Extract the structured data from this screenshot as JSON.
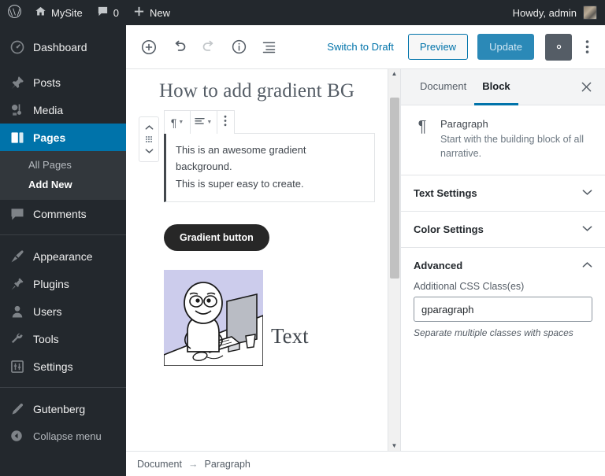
{
  "adminbar": {
    "logo_icon": "wordpress-logo-icon",
    "site": {
      "icon": "home-icon",
      "label": "MySite"
    },
    "comments": {
      "icon": "comment-bubble-icon",
      "count": "0"
    },
    "new": {
      "icon": "plus-icon",
      "label": "New"
    },
    "account": {
      "greeting": "Howdy, admin",
      "avatar": "user-avatar"
    }
  },
  "sidebar": {
    "items": [
      {
        "label": "Dashboard",
        "icon": "dashboard-icon",
        "current": false
      },
      {
        "label": "Posts",
        "icon": "pin-icon",
        "current": false
      },
      {
        "label": "Media",
        "icon": "media-icon",
        "current": false
      },
      {
        "label": "Pages",
        "icon": "pages-icon",
        "current": true
      },
      {
        "label": "Comments",
        "icon": "comment-icon",
        "current": false
      },
      {
        "label": "Appearance",
        "icon": "appearance-brush-icon",
        "current": false
      },
      {
        "label": "Plugins",
        "icon": "plugin-plug-icon",
        "current": false
      },
      {
        "label": "Users",
        "icon": "user-icon",
        "current": false
      },
      {
        "label": "Tools",
        "icon": "wrench-icon",
        "current": false
      },
      {
        "label": "Settings",
        "icon": "settings-sliders-icon",
        "current": false
      },
      {
        "label": "Gutenberg",
        "icon": "pencil-icon",
        "current": false
      }
    ],
    "submenu": [
      {
        "label": "All Pages",
        "current": false
      },
      {
        "label": "Add New",
        "current": true
      }
    ],
    "collapse": {
      "label": "Collapse menu",
      "icon": "collapse-arrow-icon"
    }
  },
  "toolbar": {
    "add_block": "add-block-icon",
    "undo": "undo-icon",
    "redo": "redo-icon",
    "info": "info-icon",
    "list_view": "list-view-icon",
    "switch_to_draft": "Switch to Draft",
    "preview": "Preview",
    "update": "Update",
    "settings_gear": "gear-icon",
    "more_menu": "kebab-menu-icon"
  },
  "canvas": {
    "post_title": "How to add gradient BG",
    "block_toolbar": {
      "paragraph_glyph": "¶",
      "align_glyph": "align-left-icon",
      "more_glyph": "kebab-menu-icon"
    },
    "mover": {
      "up": "chevron-up-icon",
      "drag": "drag-handle-icon",
      "down": "chevron-down-icon"
    },
    "paragraph_lines": [
      "This is an awesome gradient background.",
      "This is super easy to create."
    ],
    "gradient_button_label": "Gradient button",
    "media_text": "Text",
    "media_image_alt": "rage-comic-at-computer-meme"
  },
  "inspector": {
    "tabs": [
      {
        "label": "Document",
        "active": false
      },
      {
        "label": "Block",
        "active": true
      }
    ],
    "close_icon": "close-icon",
    "block_card": {
      "icon": "¶",
      "title": "Paragraph",
      "description": "Start with the building block of all narrative."
    },
    "panels": [
      {
        "label": "Text Settings",
        "expanded": false,
        "chevron": "chevron-down-icon"
      },
      {
        "label": "Color Settings",
        "expanded": false,
        "chevron": "chevron-down-icon"
      },
      {
        "label": "Advanced",
        "expanded": true,
        "chevron": "chevron-up-icon"
      }
    ],
    "advanced": {
      "field_label": "Additional CSS Class(es)",
      "field_value": "gparagraph",
      "field_placeholder": "",
      "help_text": "Separate multiple classes with spaces"
    }
  },
  "footer": {
    "crumb_root": "Document",
    "crumb_arrow": "→",
    "crumb_leaf": "Paragraph"
  },
  "colors": {
    "admin_dark": "#23282d",
    "admin_current": "#0073aa",
    "accent_blue": "#0073aa",
    "update_blue": "#2b89b7",
    "gear_slate": "#555d66",
    "gradient_button": "#272727",
    "meme_bg": "#ccccec"
  }
}
